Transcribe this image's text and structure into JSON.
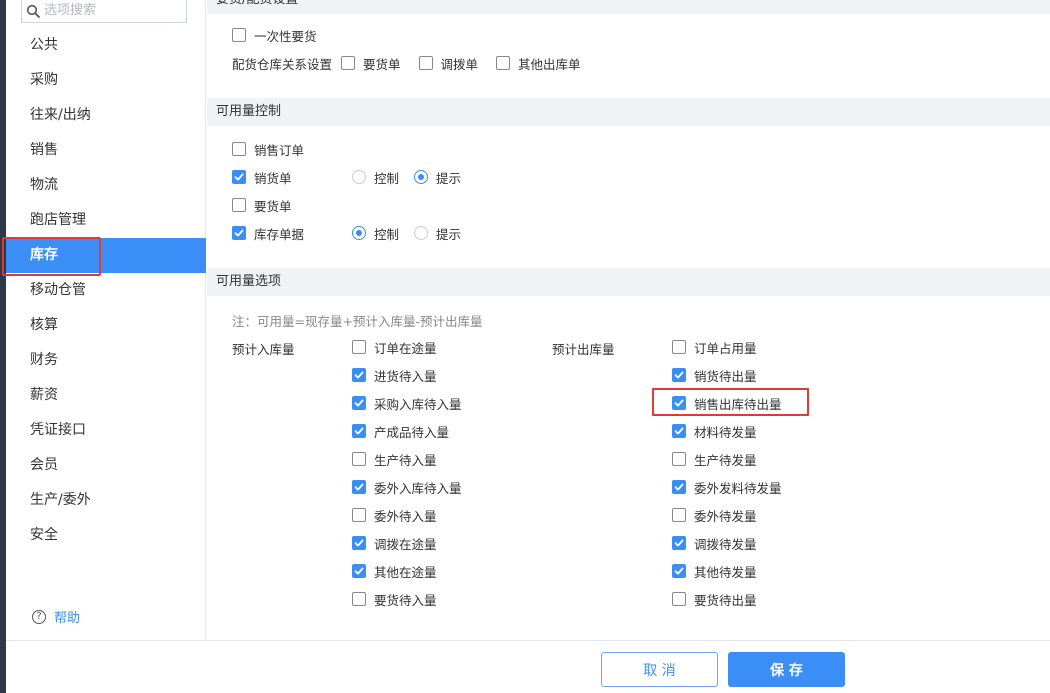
{
  "search": {
    "placeholder": "选项搜索"
  },
  "sidebar": {
    "items": [
      {
        "label": "公共"
      },
      {
        "label": "采购"
      },
      {
        "label": "往来/出纳"
      },
      {
        "label": "销售"
      },
      {
        "label": "物流"
      },
      {
        "label": "跑店管理"
      },
      {
        "label": "库存"
      },
      {
        "label": "移动仓管"
      },
      {
        "label": "核算"
      },
      {
        "label": "财务"
      },
      {
        "label": "薪资"
      },
      {
        "label": "凭证接口"
      },
      {
        "label": "会员"
      },
      {
        "label": "生产/委外"
      },
      {
        "label": "安全"
      }
    ],
    "active_label": "库存",
    "help_label": "帮助"
  },
  "section1": {
    "title": "要货/配货设置",
    "one_time": {
      "label": "一次性要货",
      "checked": false
    },
    "relation_label": "配货仓库关系设置",
    "relation_options": [
      {
        "label": "要货单",
        "checked": false
      },
      {
        "label": "调拨单",
        "checked": false
      },
      {
        "label": "其他出库单",
        "checked": false
      }
    ]
  },
  "section2": {
    "title": "可用量控制",
    "radio_labels": {
      "control": "控制",
      "hint": "提示"
    },
    "rows": [
      {
        "label": "销售订单",
        "checked": false,
        "mode": null
      },
      {
        "label": "销货单",
        "checked": true,
        "mode": "hint"
      },
      {
        "label": "要货单",
        "checked": false,
        "mode": null
      },
      {
        "label": "库存单据",
        "checked": true,
        "mode": "control"
      }
    ]
  },
  "section3": {
    "title": "可用量选项",
    "note": "注：可用量=现存量+预计入库量-预计出库量",
    "in_label": "预计入库量",
    "out_label": "预计出库量",
    "in_items": [
      {
        "label": "订单在途量",
        "checked": false
      },
      {
        "label": "进货待入量",
        "checked": true
      },
      {
        "label": "采购入库待入量",
        "checked": true
      },
      {
        "label": "产成品待入量",
        "checked": true
      },
      {
        "label": "生产待入量",
        "checked": false
      },
      {
        "label": "委外入库待入量",
        "checked": true
      },
      {
        "label": "委外待入量",
        "checked": false
      },
      {
        "label": "调拨在途量",
        "checked": true
      },
      {
        "label": "其他在途量",
        "checked": true
      },
      {
        "label": "要货待入量",
        "checked": false
      }
    ],
    "out_items": [
      {
        "label": "订单占用量",
        "checked": false
      },
      {
        "label": "销货待出量",
        "checked": true
      },
      {
        "label": "销售出库待出量",
        "checked": true
      },
      {
        "label": "材料待发量",
        "checked": true
      },
      {
        "label": "生产待发量",
        "checked": false
      },
      {
        "label": "委外发料待发量",
        "checked": true
      },
      {
        "label": "委外待发量",
        "checked": false
      },
      {
        "label": "调拨待发量",
        "checked": true
      },
      {
        "label": "其他待发量",
        "checked": true
      },
      {
        "label": "要货待出量",
        "checked": false
      }
    ]
  },
  "footer": {
    "cancel_label": "取 消",
    "save_label": "保 存"
  },
  "colors": {
    "accent": "#3a8ef6",
    "highlight": "#e03a35",
    "header_bg": "#f1f2f5"
  }
}
